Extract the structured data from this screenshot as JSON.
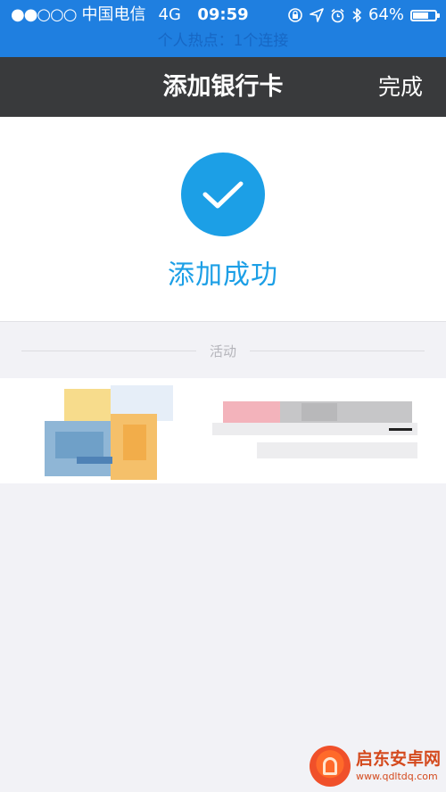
{
  "status_bar": {
    "signal": "●●○○○",
    "carrier": "中国电信",
    "network": "4G",
    "time": "09:59",
    "battery": "64%",
    "battery_level": 0.64,
    "hotspot_text": "个人热点：1个连接"
  },
  "nav": {
    "title": "添加银行卡",
    "done_label": "完成"
  },
  "success": {
    "message": "添加成功",
    "icon": "check-icon",
    "accent_color": "#1c9fe6"
  },
  "activity": {
    "label": "活动"
  },
  "watermark": {
    "title": "启东安卓网",
    "url": "www.qdltdq.com"
  }
}
